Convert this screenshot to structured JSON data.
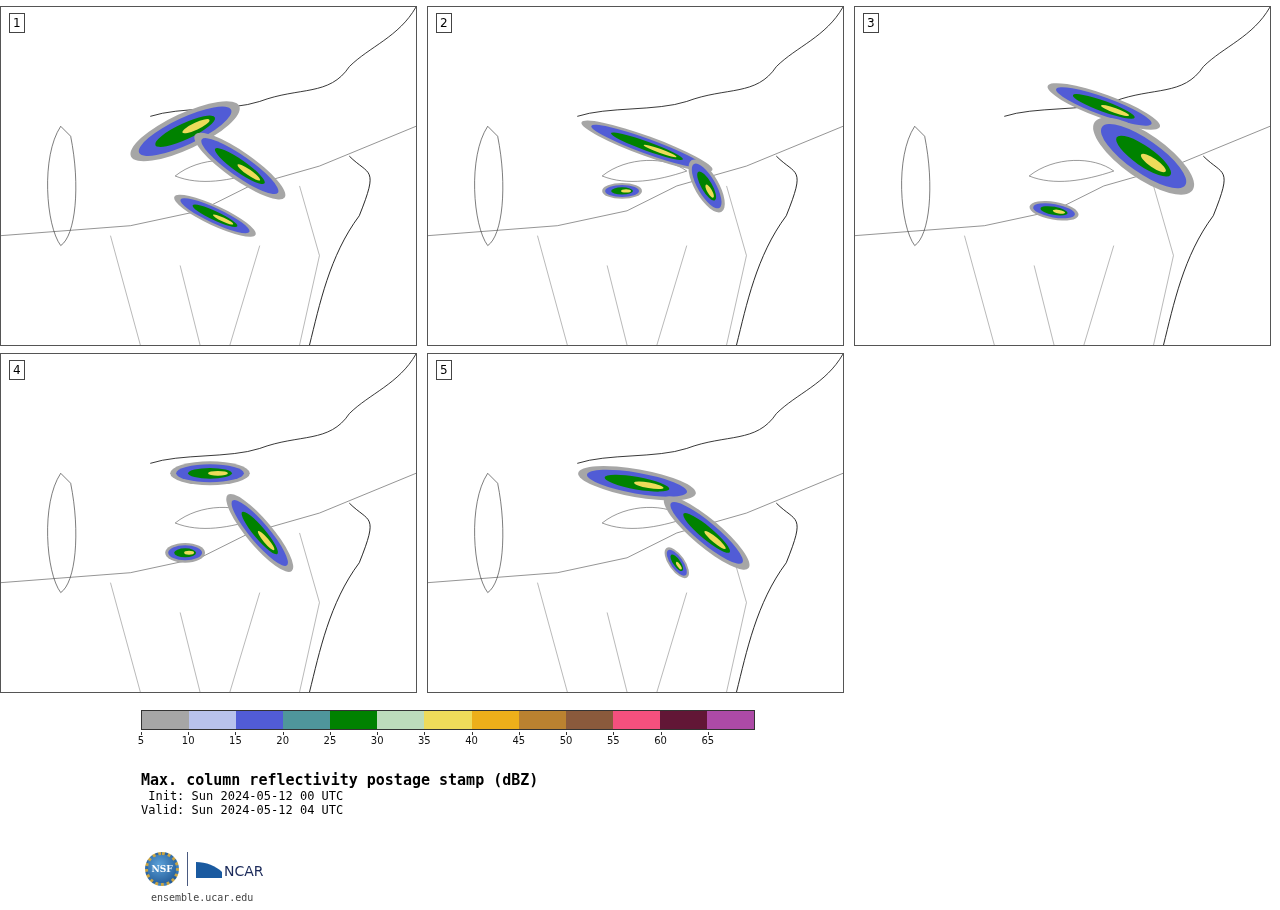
{
  "panels": [
    {
      "label": "1"
    },
    {
      "label": "2"
    },
    {
      "label": "3"
    },
    {
      "label": "4"
    },
    {
      "label": "5"
    }
  ],
  "colorbar": {
    "segments": [
      {
        "color": "#a6a6a6"
      },
      {
        "color": "#b8c2ec"
      },
      {
        "color": "#515cd6"
      },
      {
        "color": "#4f969b"
      },
      {
        "color": "#008200"
      },
      {
        "color": "#bddcbb"
      },
      {
        "color": "#eedb5a"
      },
      {
        "color": "#edaf1a"
      },
      {
        "color": "#ba8230"
      },
      {
        "color": "#8a5a3c"
      },
      {
        "color": "#f4507e"
      },
      {
        "color": "#621636"
      },
      {
        "color": "#ad4aa7"
      }
    ],
    "ticks": [
      "5",
      "10",
      "15",
      "20",
      "25",
      "30",
      "35",
      "40",
      "45",
      "50",
      "55",
      "60",
      "65"
    ]
  },
  "title": "Max. column reflectivity postage stamp (dBZ)",
  "info_lines": [
    {
      "label": "Init:",
      "value": "Sun 2024-05-12 00 UTC"
    },
    {
      "label": "Valid:",
      "value": "Sun 2024-05-12 04 UTC"
    }
  ],
  "logos": {
    "nsf": "NSF",
    "ncar": "NCAR"
  },
  "url": "ensemble.ucar.edu"
}
